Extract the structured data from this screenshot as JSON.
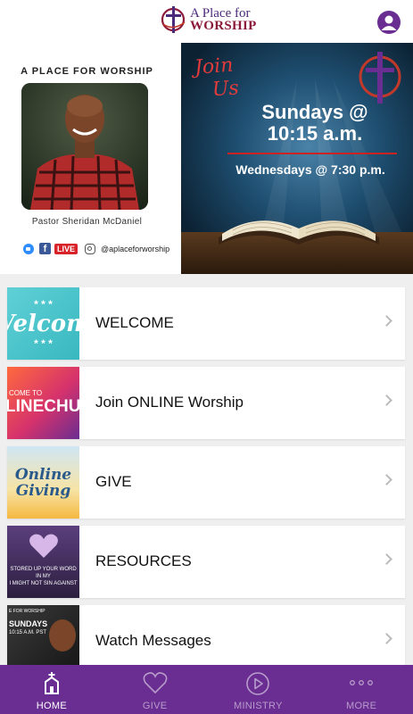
{
  "header": {
    "logo_line1": "A Place for",
    "logo_line2": "WORSHIP"
  },
  "hero": {
    "title": "A PLACE FOR WORSHIP",
    "pastor_name": "Pastor Sheridan McDaniel",
    "social": {
      "facebook_letter": "f",
      "live_label": "LIVE",
      "handle": "@aplaceforworship"
    },
    "banner": {
      "join_line1": "Join",
      "join_line2": "Us",
      "sundays_line1": "Sundays @",
      "sundays_line2": "10:15 a.m.",
      "wednesdays": "Wednesdays @ 7:30 p.m."
    }
  },
  "list": {
    "items": [
      {
        "label": "WELCOME",
        "thumb_text": "Welcom",
        "thumb_icon": "welcome-graphic"
      },
      {
        "label": "Join ONLINE Worship",
        "thumb_text": "LINECHU",
        "thumb_text_small": "COME TO",
        "thumb_icon": "online-church-graphic"
      },
      {
        "label": "GIVE",
        "thumb_text": "Online Giving",
        "thumb_icon": "online-giving-graphic"
      },
      {
        "label": "RESOURCES",
        "thumb_text": "STORED UP YOUR WORD IN MY",
        "thumb_text2": "I MIGHT NOT SIN AGAINST",
        "thumb_icon": "heart-bible-graphic"
      },
      {
        "label": "Watch Messages",
        "thumb_text": "SUNDAYS",
        "thumb_text2": "10:15 A.M. PST",
        "thumb_text3": "E FOR WORSHIP",
        "thumb_icon": "pastor-message-graphic"
      }
    ]
  },
  "tabbar": {
    "tabs": [
      {
        "label": "HOME",
        "icon": "church-icon",
        "active": true
      },
      {
        "label": "GIVE",
        "icon": "heart-icon",
        "active": false
      },
      {
        "label": "MINISTRY",
        "icon": "play-icon",
        "active": false
      },
      {
        "label": "MORE",
        "icon": "more-dots-icon",
        "active": false
      }
    ]
  },
  "colors": {
    "brand_purple": "#6a2d91",
    "accent_red": "#d8232a"
  }
}
